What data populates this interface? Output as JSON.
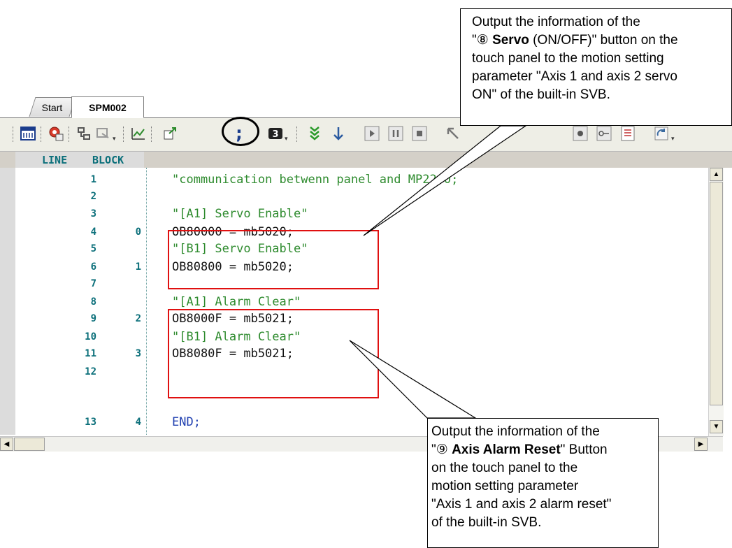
{
  "tabs": [
    {
      "label": "Start"
    },
    {
      "label": "SPM002"
    }
  ],
  "columns": {
    "line": "LINE",
    "block": "BLOCK"
  },
  "toolbar_icons": [
    "ladder-icon",
    "monitor-icon",
    "compile-icon",
    "window-icon",
    "chart-icon",
    "export-icon",
    "semicolon-icon",
    "number-icon",
    "step-over-icon",
    "step-down-icon",
    "play-icon",
    "pause-icon",
    "stop-icon",
    "back-icon",
    "breakpoint-icon",
    "breakpoint-link-icon",
    "list-icon",
    "refresh-icon"
  ],
  "selected_tool": {
    "glyph": ";"
  },
  "lines": [
    {
      "line": "1",
      "block": "",
      "code": "\"communication betwenn panel and MP2200;",
      "style": "cm"
    },
    {
      "line": "2",
      "block": "",
      "code": "",
      "style": "cm"
    },
    {
      "line": "3",
      "block": "",
      "code": "\"[A1] Servo Enable\"",
      "style": "cm"
    },
    {
      "line": "4",
      "block": "0",
      "code": "OB80000 = mb5020;",
      "style": "st"
    },
    {
      "line": "5",
      "block": "",
      "code": "\"[B1] Servo Enable\"",
      "style": "cm"
    },
    {
      "line": "6",
      "block": "1",
      "code": "OB80800 = mb5020;",
      "style": "st"
    },
    {
      "line": "7",
      "block": "",
      "code": "",
      "style": "cm"
    },
    {
      "line": "8",
      "block": "",
      "code": "\"[A1] Alarm Clear\"",
      "style": "cm"
    },
    {
      "line": "9",
      "block": "2",
      "code": "OB8000F = mb5021;",
      "style": "st"
    },
    {
      "line": "10",
      "block": "",
      "code": "\"[B1] Alarm Clear\"",
      "style": "cm"
    },
    {
      "line": "11",
      "block": "3",
      "code": "OB8080F = mb5021;",
      "style": "st"
    },
    {
      "line": "12",
      "block": "",
      "code": "",
      "style": "cm"
    },
    {
      "line": "13",
      "block": "4",
      "code": "END;",
      "style": "kw"
    }
  ],
  "callout_servo": {
    "line1": "Output the information of the",
    "line2_pre": "\"⑧ ",
    "line2_bold": "Servo",
    "line2_post": " (ON/OFF)\" button on the",
    "line3": "touch panel to the motion setting",
    "line4": "parameter \"Axis 1 and axis 2 servo",
    "line5": "ON\" of the built-in SVB."
  },
  "callout_alarm": {
    "line1": "Output the information of the",
    "line2_pre": "\"⑨ ",
    "line2_bold": "Axis Alarm Reset",
    "line2_post": "\" Button",
    "line3": "on the touch panel to the",
    "line4": "motion setting parameter",
    "line5": "\"Axis 1 and axis 2 alarm reset\"",
    "line6": "of the built-in SVB."
  },
  "colors": {
    "highlight": "#e01010",
    "comment": "#2e8b2e",
    "keyword": "#1f3fb0",
    "line_number": "#0b6f7a"
  }
}
